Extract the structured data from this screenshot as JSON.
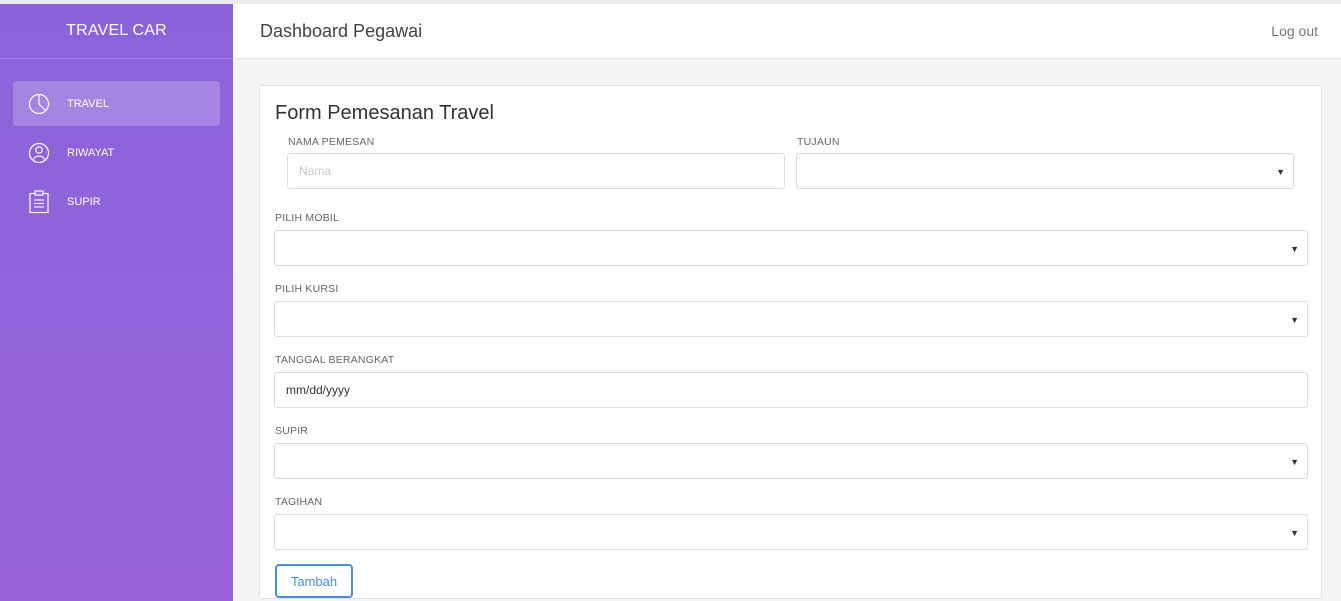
{
  "app": {
    "brand": "TRAVEL CAR"
  },
  "header": {
    "title": "Dashboard Pegawai",
    "logout_label": "Log out"
  },
  "sidebar": {
    "items": [
      {
        "label": "TRAVEL",
        "icon": "pie-chart-icon",
        "active": true
      },
      {
        "label": "RIWAYAT",
        "icon": "user-circle-icon",
        "active": false
      },
      {
        "label": "SUPIR",
        "icon": "clipboard-icon",
        "active": false
      }
    ]
  },
  "form": {
    "title": "Form Pemesanan Travel",
    "nama_pemesan": {
      "label": "NAMA PEMESAN",
      "placeholder": "Nama",
      "value": ""
    },
    "tujuan": {
      "label": "TUJAUN",
      "value": ""
    },
    "pilih_mobil": {
      "label": "PILIH MOBIL",
      "value": ""
    },
    "pilih_kursi": {
      "label": "PILIH KURSI",
      "value": ""
    },
    "tanggal_berangkat": {
      "label": "TANGGAL BERANGKAT",
      "value": "mm/dd/yyyy"
    },
    "supir": {
      "label": "SUPIR",
      "value": ""
    },
    "tagihan": {
      "label": "TAGIHAN",
      "value": ""
    },
    "submit_label": "Tambah"
  },
  "colors": {
    "sidebar": "#8f63da",
    "accent": "#4b8fd6"
  }
}
